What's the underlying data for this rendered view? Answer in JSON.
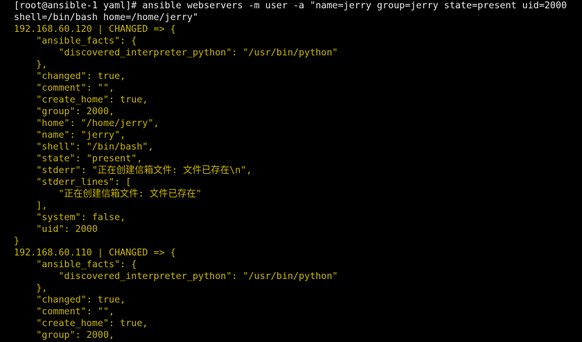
{
  "terminal": {
    "lines": [
      {
        "text": "[root@ansible-1 yaml]# ansible webservers -m user -a \"name=jerry group=jerry state=present uid=2000",
        "kind": "command"
      },
      {
        "text": "shell=/bin/bash home=/home/jerry\"",
        "kind": "command"
      },
      {
        "text": "192.168.60.120 | CHANGED => {",
        "kind": "output"
      },
      {
        "text": "    \"ansible_facts\": {",
        "kind": "output"
      },
      {
        "text": "        \"discovered_interpreter_python\": \"/usr/bin/python\"",
        "kind": "output"
      },
      {
        "text": "    },",
        "kind": "output"
      },
      {
        "text": "    \"changed\": true,",
        "kind": "output"
      },
      {
        "text": "    \"comment\": \"\",",
        "kind": "output"
      },
      {
        "text": "    \"create_home\": true,",
        "kind": "output"
      },
      {
        "text": "    \"group\": 2000,",
        "kind": "output"
      },
      {
        "text": "    \"home\": \"/home/jerry\",",
        "kind": "output"
      },
      {
        "text": "    \"name\": \"jerry\",",
        "kind": "output"
      },
      {
        "text": "    \"shell\": \"/bin/bash\",",
        "kind": "output"
      },
      {
        "text": "    \"state\": \"present\",",
        "kind": "output"
      },
      {
        "text": "    \"stderr\": \"正在创建信箱文件: 文件已存在\\n\",",
        "kind": "output"
      },
      {
        "text": "    \"stderr_lines\": [",
        "kind": "output"
      },
      {
        "text": "        \"正在创建信箱文件: 文件已存在\"",
        "kind": "output"
      },
      {
        "text": "    ],",
        "kind": "output"
      },
      {
        "text": "    \"system\": false,",
        "kind": "output"
      },
      {
        "text": "    \"uid\": 2000",
        "kind": "output"
      },
      {
        "text": "}",
        "kind": "output"
      },
      {
        "text": "192.168.60.110 | CHANGED => {",
        "kind": "output"
      },
      {
        "text": "    \"ansible_facts\": {",
        "kind": "output"
      },
      {
        "text": "        \"discovered_interpreter_python\": \"/usr/bin/python\"",
        "kind": "output"
      },
      {
        "text": "    },",
        "kind": "output"
      },
      {
        "text": "    \"changed\": true,",
        "kind": "output"
      },
      {
        "text": "    \"comment\": \"\",",
        "kind": "output"
      },
      {
        "text": "    \"create_home\": true,",
        "kind": "output"
      },
      {
        "text": "    \"group\": 2000,",
        "kind": "output"
      }
    ]
  }
}
